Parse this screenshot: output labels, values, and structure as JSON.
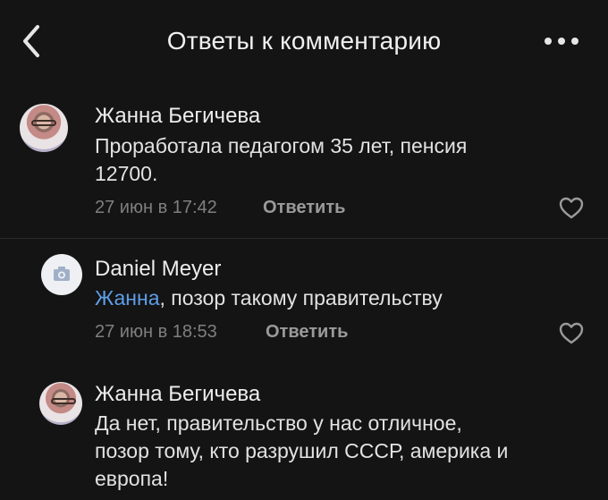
{
  "header": {
    "title": "Ответы к комментарию",
    "back_icon": "chevron-left-icon",
    "more_icon": "more-horizontal-icon"
  },
  "comments": [
    {
      "author": "Жанна Бегичева",
      "text_lines": [
        "Проработала педагогом 35 лет, пенсия",
        "12700."
      ],
      "timestamp": "27 июн в 17:42",
      "reply_label": "Ответить",
      "avatar": "user-photo"
    },
    {
      "author": "Daniel Meyer",
      "mention": "Жанна",
      "text_rest": ", позор такому правительству",
      "timestamp": "27 июн в 18:53",
      "reply_label": "Ответить",
      "avatar": "camera-icon"
    },
    {
      "author": "Жанна Бегичева",
      "text_lines": [
        "Да нет, правительство у нас отличное,",
        "позор тому, кто разрушил СССР, америка и",
        "европа!"
      ],
      "avatar": "user-photo"
    }
  ],
  "colors": {
    "background": "#141414",
    "mention": "#5e9ee8",
    "meta": "#7f7f7f"
  }
}
